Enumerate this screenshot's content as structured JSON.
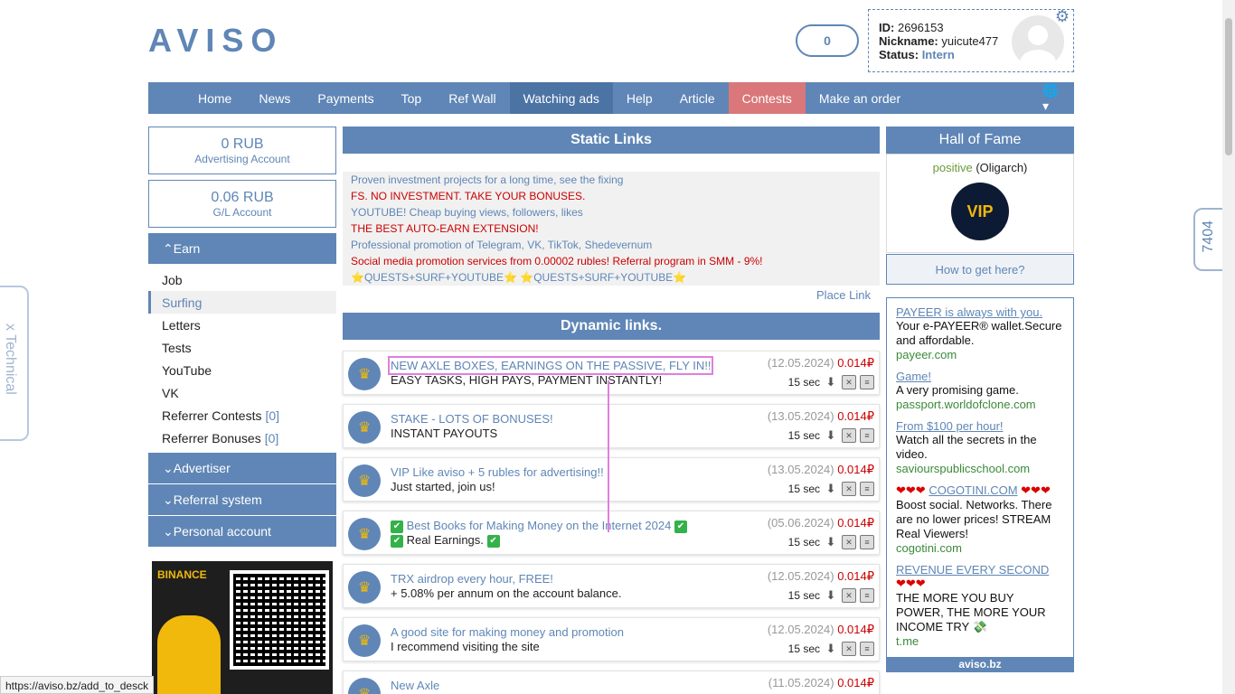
{
  "header": {
    "logo": "AVISO",
    "balance": "0",
    "user": {
      "id_label": "ID:",
      "id": "2696153",
      "nick_label": "Nickname:",
      "nick": "yuicute477",
      "status_label": "Status:",
      "status": "Intern"
    }
  },
  "nav": [
    "Home",
    "News",
    "Payments",
    "Top",
    "Ref Wall",
    "Watching ads",
    "Help",
    "Article",
    "Contests",
    "Make an order"
  ],
  "accounts": [
    {
      "amount": "0 RUB",
      "label": "Advertising Account"
    },
    {
      "amount": "0.06 RUB",
      "label": "G/L Account"
    }
  ],
  "menu": {
    "earn": "Earn",
    "items": [
      "Job",
      "Surfing",
      "Letters",
      "Tests",
      "YouTube",
      "VK",
      "Referrer Contests",
      "Referrer Bonuses"
    ],
    "counts": [
      "[0]",
      "[0]"
    ],
    "advertiser": "Advertiser",
    "referral": "Referral system",
    "personal": "Personal account"
  },
  "binance_label": "BINANCE",
  "static": {
    "title": "Static Links",
    "links": [
      "Proven investment projects for a long time, see the fixing",
      "FS. NO INVESTMENT. TAKE YOUR BONUSES.",
      "YOUTUBE! Cheap buying views, followers, likes",
      "THE BEST AUTO-EARN EXTENSION!",
      "Professional promotion of Telegram, VK, TikTok, Shedevernum",
      "Social media promotion services from 0.00002 rubles! Referral program in SMM - 9%!",
      "⭐QUESTS+SURF+YOUTUBE⭐ ⭐QUESTS+SURF+YOUTUBE⭐"
    ],
    "place": "Place Link"
  },
  "dynamic": {
    "title": "Dynamic links.",
    "rows": [
      {
        "title": "NEW AXLE BOXES, EARNINGS ON THE PASSIVE, FLY IN!!",
        "desc": "EASY TASKS, HIGH PAYS, PAYMENT INSTANTLY!",
        "date": "(12.05.2024)",
        "price": "0.014₽",
        "time": "15 sec"
      },
      {
        "title": "STAKE - LOTS OF BONUSES!",
        "desc": "INSTANT PAYOUTS",
        "date": "(13.05.2024)",
        "price": "0.014₽",
        "time": "15 sec"
      },
      {
        "title": "VIP Like aviso + 5 rubles for advertising!!",
        "desc": "Just started, join us!",
        "date": "(13.05.2024)",
        "price": "0.014₽",
        "time": "15 sec"
      },
      {
        "title": "Best Books for Making Money on the Internet 2024",
        "desc": "Real Earnings.",
        "date": "(05.06.2024)",
        "price": "0.014₽",
        "time": "15 sec"
      },
      {
        "title": "TRX airdrop every hour, FREE!",
        "desc": "+ 5.08% per annum on the account balance.",
        "date": "(12.05.2024)",
        "price": "0.014₽",
        "time": "15 sec"
      },
      {
        "title": "A good site for making money and promotion",
        "desc": "I recommend visiting the site",
        "date": "(12.05.2024)",
        "price": "0.014₽",
        "time": "15 sec"
      },
      {
        "title": "New Axle",
        "desc": "",
        "date": "(11.05.2024)",
        "price": "0.014₽",
        "time": ""
      }
    ]
  },
  "hof": {
    "title": "Hall of Fame",
    "name": "positive",
    "rank": "(Oligarch)",
    "vip": "VIP",
    "how": "How to get here?"
  },
  "ads": [
    {
      "title": "PAYEER is always with you.",
      "desc": "Your e-PAYEER® wallet.Secure and affordable.",
      "url": "payeer.com"
    },
    {
      "title": "Game!",
      "desc": "A very promising game.",
      "url": "passport.worldofclone.com"
    },
    {
      "title": "From $100 per hour!",
      "desc": "Watch all the secrets in the video.",
      "url": "saviourspublicschool.com"
    },
    {
      "title": "COGOTINI.COM",
      "desc": "Boost social. Networks. There are no lower prices! STREAM Real Viewers!",
      "url": "cogotini.com"
    },
    {
      "title": "REVENUE EVERY SECOND",
      "desc": "THE MORE YOU BUY POWER, THE MORE YOUR INCOME TRY 💸",
      "url": "t.me"
    }
  ],
  "ads_footer": "aviso.bz",
  "side_left": "x Technical",
  "side_right": "7404",
  "status_url": "https://aviso.bz/add_to_desck",
  "colors": {
    "accent": "#5f86b6",
    "contests": "#d9777a",
    "price": "#cc0000"
  }
}
